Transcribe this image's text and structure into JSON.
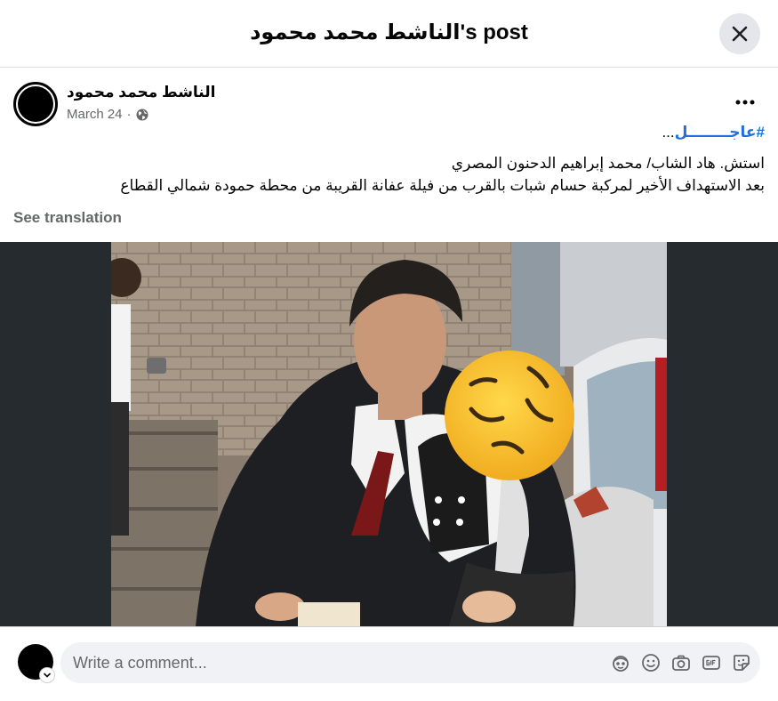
{
  "header": {
    "title": "الناشط محمد محمود's post"
  },
  "post": {
    "author": "الناشط محمد محمود",
    "date": "March 24",
    "separator": "·",
    "hashtag": "#عاجــــــــل",
    "hashtag_suffix": "...",
    "line1": "استش. هاد الشاب/ محمد إبراهيم الدحنون المصري",
    "line2": "بعد الاستهداف الأخير لمركبة حسام شبات بالقرب من فيلة عفانة القريبة من محطة حمودة شمالي القطاع",
    "see_translation": "See translation"
  },
  "comment": {
    "placeholder": "Write a comment..."
  },
  "icons": [
    "close-icon",
    "globe-icon",
    "more-options-icon",
    "avatar-sticker-icon",
    "emoji-icon",
    "camera-icon",
    "gif-icon",
    "sticker-icon",
    "chevron-down-icon"
  ],
  "colors": {
    "hashtag": "#216fdb",
    "secondary_text": "#65676b",
    "input_bg": "#f0f2f5",
    "button_bg": "#e4e6eb",
    "media_bg": "#252b2e",
    "emoji_face": "#f7c233"
  }
}
